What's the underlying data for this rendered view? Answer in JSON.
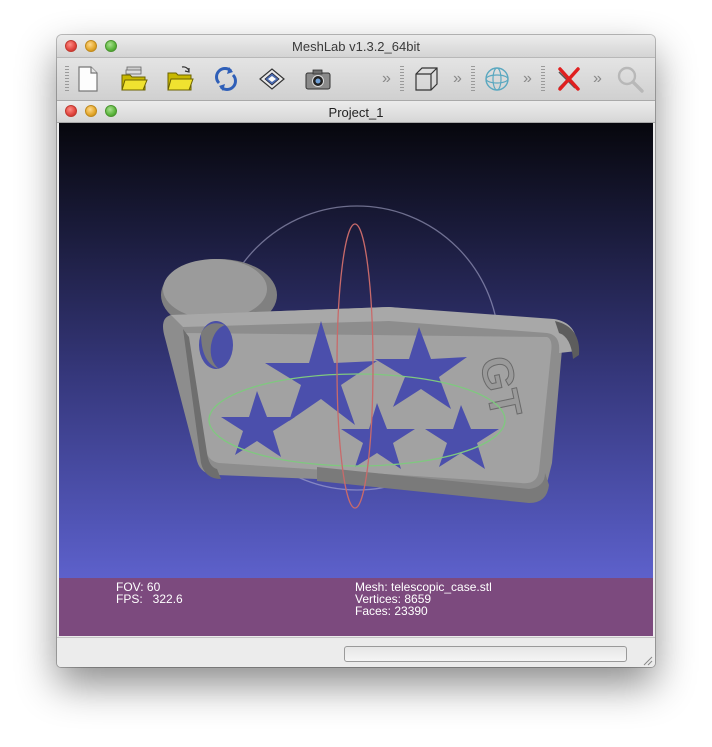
{
  "window": {
    "title": "MeshLab v1.3.2_64bit"
  },
  "toolbar": {
    "buttons": [
      {
        "icon": "new-document-icon"
      },
      {
        "icon": "open-project-icon"
      },
      {
        "icon": "open-mesh-icon"
      },
      {
        "icon": "reload-icon"
      },
      {
        "icon": "save-icon"
      },
      {
        "icon": "snapshot-icon"
      },
      {
        "icon": "bounding-box-icon"
      },
      {
        "icon": "trackball-icon"
      },
      {
        "icon": "delete-icon"
      },
      {
        "icon": "magnifier-icon"
      }
    ],
    "overflow_glyph": "»"
  },
  "subwindow": {
    "title": "Project_1"
  },
  "info": {
    "fov": "FOV: 60",
    "fps": "FPS:   322.6",
    "mesh": "Mesh: telescopic_case.stl",
    "vertices": "Vertices: 8659",
    "faces": "Faces: 23390"
  },
  "model": {
    "embossed_text": "GT"
  },
  "colors": {
    "info_bar": "#7c4a7e",
    "model": "#9a9a9a",
    "trackball_red": "#c86a6a",
    "trackball_green": "#7fc87f"
  }
}
